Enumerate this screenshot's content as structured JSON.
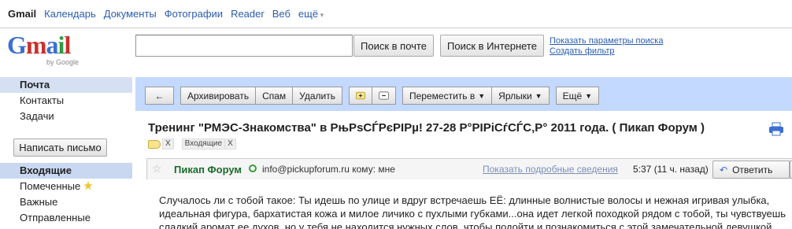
{
  "topnav": {
    "items": [
      "Gmail",
      "Календарь",
      "Документы",
      "Фотографии",
      "Reader",
      "Веб",
      "ещё"
    ]
  },
  "logo": {
    "by": "by Google"
  },
  "search": {
    "placeholder": "",
    "mail_button": "Поиск в почте",
    "web_button": "Поиск в Интернете",
    "options_link": "Показать параметры поиска",
    "filter_link": "Создать фильтр"
  },
  "sidebar": {
    "top_items": [
      "Почта",
      "Контакты",
      "Задачи"
    ],
    "compose": "Написать письмо",
    "folders": [
      "Входящие",
      "Помеченные",
      "Важные",
      "Отправленные"
    ]
  },
  "toolbar": {
    "back": "←",
    "archive": "Архивировать",
    "spam": "Спам",
    "delete": "Удалить",
    "move": "Переместить в",
    "labels": "Ярлыки",
    "more": "Ещё"
  },
  "message": {
    "subject": "Тренинг \"РМЭС-Знакомства\" в РњРѕСЃРєРІРµ! 27-28 Р°РІРіСѓСЃС‚Р° 2011 года. ( Пикап Форум )",
    "label_inbox": "Входящие",
    "label_close": "X",
    "sender": "Пикап Форум",
    "sender_email": "info@pickupforum.ru",
    "to": "кому: мне",
    "details": "Показать подробные сведения",
    "time": "5:37 (11 ч. назад)",
    "reply": "Ответить",
    "body": [
      "Случалось ли с тобой такое: Ты идешь по улице и вдруг встречаешь ЕЁ: длинные волнистые волосы и нежная игривая улыбка,",
      "идеальная фигура, бархатистая кожа и милое личико с пухлыми губками...она идет легкой походкой рядом с тобой, ты чувствуешь",
      "сладкий аромат ее духов, но у тебя не находится нужных слов, чтобы подойти и познакомиться с этой замечательной девушкой."
    ]
  }
}
